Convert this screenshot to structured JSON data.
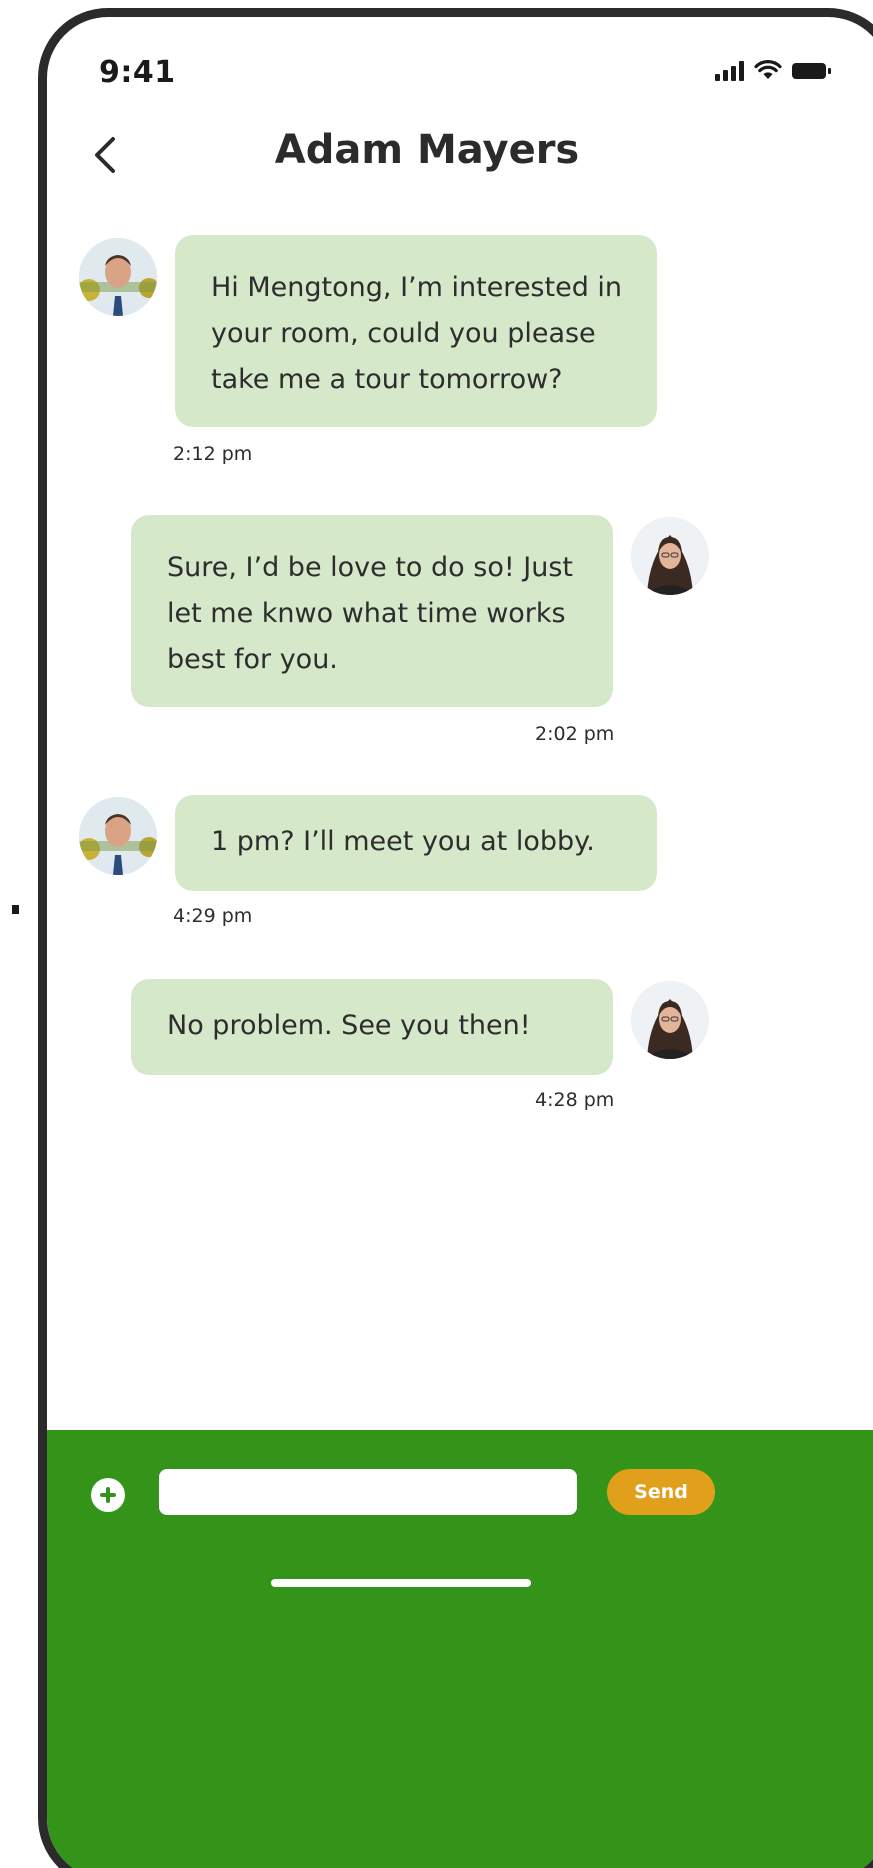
{
  "status_bar": {
    "time": "9:41"
  },
  "header": {
    "title": "Adam Mayers"
  },
  "messages": [
    {
      "sender": "other",
      "lines": [
        "Hi Mengtong, I’m interested in",
        "your room, could you please",
        "take me a tour tomorrow?"
      ],
      "time": "2:12 pm"
    },
    {
      "sender": "self",
      "lines": [
        "Sure, I’d be love to do so! Just",
        "let me knwo what time works",
        "best for you."
      ],
      "time": "2:02 pm"
    },
    {
      "sender": "other",
      "lines": [
        "1 pm? I’ll meet you at lobby."
      ],
      "time": "4:29 pm"
    },
    {
      "sender": "self",
      "lines": [
        "No problem. See you then!"
      ],
      "time": "4:28 pm"
    }
  ],
  "composer": {
    "value": "",
    "send_label": "Send"
  },
  "colors": {
    "bubble": "#d5e8ca",
    "bar": "#34941a",
    "send": "#e0a01c"
  }
}
